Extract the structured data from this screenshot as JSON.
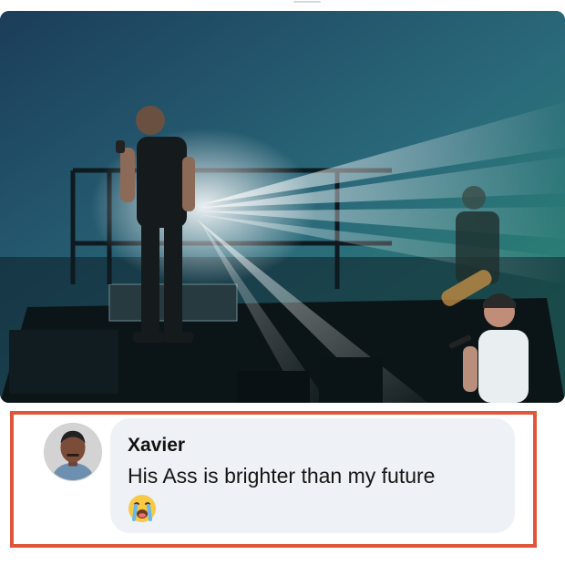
{
  "post": {
    "image": {
      "description_icon": "concert-stage-photo"
    }
  },
  "comment": {
    "author": "Xavier",
    "text": "His Ass is brighter than my future",
    "reaction_icon": "crying-face-icon"
  },
  "colors": {
    "frame_border": "#e0563b",
    "bubble_background": "#eef1f5"
  }
}
